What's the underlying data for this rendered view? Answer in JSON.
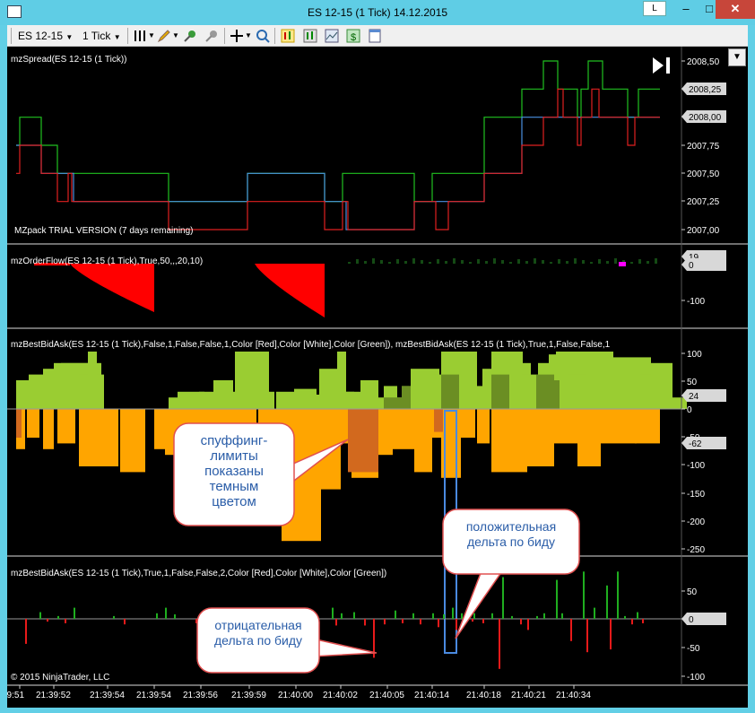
{
  "window": {
    "title": "ES 12-15 (1 Tick)  14.12.2015",
    "btn_l": "L",
    "btn_min": "–",
    "btn_max": "□",
    "btn_close": "✕"
  },
  "toolbar": {
    "instrument": "ES 12-15",
    "interval": "1 Tick",
    "icons": [
      "bars-icon",
      "pencil-icon",
      "zoom-in-icon",
      "zoom-out-icon",
      "crosshair-icon",
      "magnifier-icon",
      "chart-trader-icon",
      "data-box-icon",
      "chart-style-icon",
      "dollar-icon",
      "properties-icon"
    ]
  },
  "panels": [
    {
      "label": "mzSpread(ES 12-15 (1 Tick))",
      "watermark": "MZpack TRIAL VERSION (7 days remaining)",
      "axis_ticks": [
        "2008,50",
        "2008,25",
        "2008,00",
        "2007,75",
        "2007,50",
        "2007,25",
        "2007,00"
      ],
      "tags": [
        "2008,25",
        "2008,00"
      ]
    },
    {
      "label": "mzOrderFlow(ES 12-15 (1 Tick),True,50,,,20,10)",
      "axis_ticks": [
        "-100"
      ],
      "tags": [
        "19",
        "0"
      ]
    },
    {
      "label": "mzBestBidAsk(ES 12-15 (1 Tick),False,1,False,False,1,Color [Red],Color [White],Color [Green]), mzBestBidAsk(ES 12-15 (1 Tick),True,1,False,False,1",
      "axis_ticks": [
        "100",
        "50",
        "0",
        "-50",
        "-100",
        "-150",
        "-200",
        "-250"
      ],
      "tags": [
        "24",
        "-62"
      ]
    },
    {
      "label": "mzBestBidAsk(ES 12-15 (1 Tick),True,1,False,False,2,Color [Red],Color [White],Color [Green])",
      "axis_ticks": [
        "50",
        "0",
        "-50",
        "-100"
      ],
      "tags": [
        "0"
      ]
    }
  ],
  "copyright": "© 2015 NinjaTrader, LLC",
  "time_axis": [
    "39:51",
    "21:39:52",
    "21:39:54",
    "21:39:54",
    "21:39:56",
    "21:39:59",
    "21:40:00",
    "21:40:02",
    "21:40:05",
    "21:40:14",
    "21:40:18",
    "21:40:21",
    "21:40:34"
  ],
  "callouts": {
    "spoofing": [
      "спуффинг-",
      "лимиты",
      "показаны",
      "темным",
      "цветом"
    ],
    "positive": [
      "положительная",
      "дельта по биду"
    ],
    "negative": [
      "отрицательная",
      "дельта по биду"
    ]
  },
  "colors": {
    "background": "#000000",
    "bid_line": "#e02020",
    "ask_line": "#20c020",
    "spread_line": "#4a90e0",
    "orderflow_red": "#ff0000",
    "ask_bars": "#9acd32",
    "ask_bars_dark": "#6b8e23",
    "bid_bars": "#ffa500",
    "bid_bars_dark": "#d2691e",
    "callout_border": "#e05050"
  }
}
